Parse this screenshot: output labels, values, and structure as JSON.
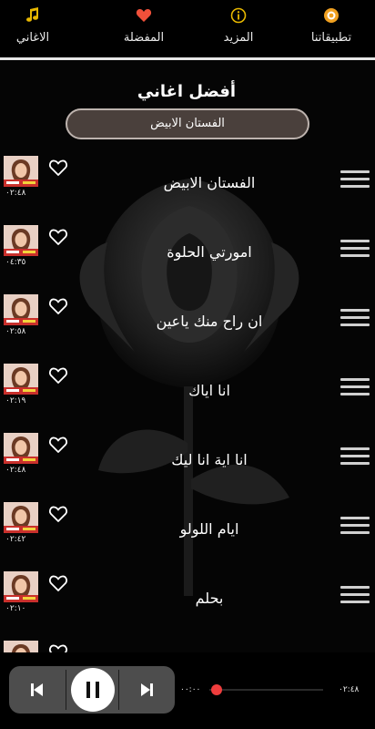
{
  "nav": {
    "songs": {
      "label": "الاغاني",
      "icon": "music-note-icon"
    },
    "favorites": {
      "label": "المفضلة",
      "icon": "heart-icon"
    },
    "more": {
      "label": "المزيد",
      "icon": "info-icon"
    },
    "apps": {
      "label": "تطبيقاتنا",
      "icon": "apps-icon"
    }
  },
  "colors": {
    "accent": "#ef3d3d",
    "nav_icon": "#e8b800",
    "pill_bg": "#4a403c"
  },
  "section_title": "أفضل اغاني",
  "now_playing": "الفستان الابيض",
  "songs": [
    {
      "title": "الفستان الابيض",
      "duration": "٠٢:٤٨"
    },
    {
      "title": "امورتي الحلوة",
      "duration": "٠٤:٣٥"
    },
    {
      "title": "ان راح منك ياعين",
      "duration": "٠٢:٥٨"
    },
    {
      "title": "انا اياك",
      "duration": "٠٢:١٩"
    },
    {
      "title": "انا اية انا ليك",
      "duration": "٠٢:٤٨"
    },
    {
      "title": "ايام اللولو",
      "duration": "٠٢:٤٢"
    },
    {
      "title": "بحلم",
      "duration": "٠٢:١٠"
    },
    {
      "title": "",
      "duration": ""
    }
  ],
  "player": {
    "current_time": "٠٠:٠٠",
    "total_time": "٠٢:٤٨",
    "progress": 0.0
  }
}
